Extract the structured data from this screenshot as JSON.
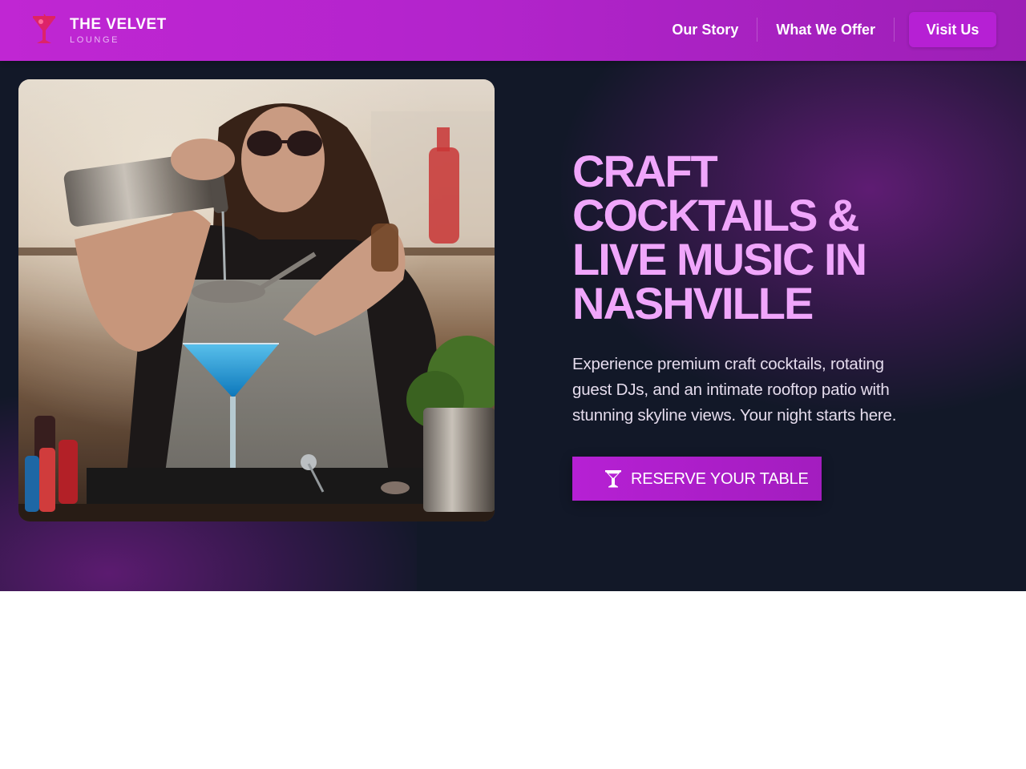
{
  "brand": {
    "name": "THE VELVET",
    "tagline": "LOUNGE",
    "logo_icon": "cocktail-glass-icon"
  },
  "nav": {
    "links": [
      {
        "label": "Our Story"
      },
      {
        "label": "What We Offer"
      }
    ],
    "cta_label": "Visit Us"
  },
  "hero": {
    "title": "CRAFT COCKTAILS & LIVE MUSIC IN NASHVILLE",
    "description": "Experience premium craft cocktails, rotating guest DJs, and an intimate rooftop patio with stunning skyline views. Your night starts here.",
    "cta_label": "RESERVE YOUR TABLE",
    "cta_icon": "martini-glass-icon",
    "image_subject": "bartender pouring blue cocktail into martini glass"
  },
  "colors": {
    "header_bg": "#b324cc",
    "hero_bg": "#121828",
    "title": "#f0a6fb",
    "accent": "#b620d4",
    "logo_icon": "#e0245e"
  }
}
